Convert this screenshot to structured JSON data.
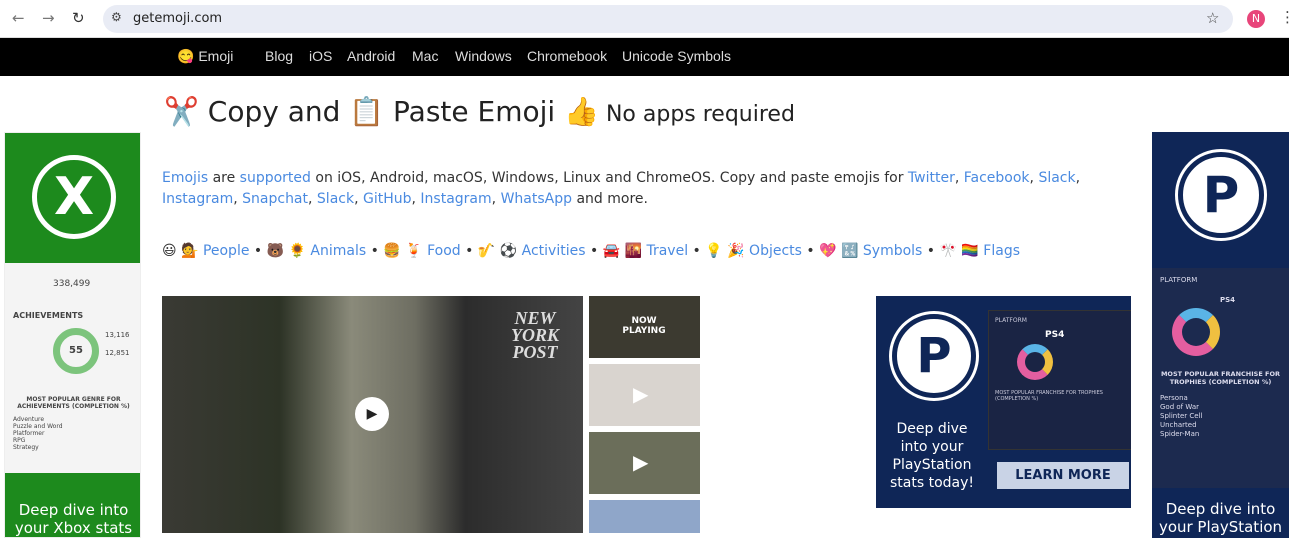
{
  "browser": {
    "url": "getemoji.com",
    "avatar": "N",
    "back": "←",
    "forward": "→",
    "reload": "↻",
    "star": "☆",
    "menu": "⋮"
  },
  "nav": {
    "items": [
      {
        "label": "😋 Emoji"
      },
      {
        "label": "Blog"
      },
      {
        "label": "iOS"
      },
      {
        "label": "Android"
      },
      {
        "label": "Mac"
      },
      {
        "label": "Windows"
      },
      {
        "label": "Chromebook"
      },
      {
        "label": "Unicode Symbols"
      }
    ]
  },
  "heading": {
    "scissors": "✂️",
    "part1": " Copy and ",
    "clipboard": "📋",
    "part2": " Paste Emoji ",
    "thumb": "👍",
    "tagline": " No apps required"
  },
  "intro": {
    "emojis": "Emojis",
    "are": " are ",
    "supported": "supported",
    "t1": " on iOS, Android, macOS, Windows, Linux and ChromeOS. Copy and paste emojis for ",
    "links": [
      "Twitter",
      "Facebook",
      "Slack",
      "Instagram",
      "Snapchat",
      "Slack",
      "GitHub",
      "Instagram",
      "WhatsApp"
    ],
    "end": " and more."
  },
  "categories": [
    {
      "emoji": "😃 💁",
      "label": "People"
    },
    {
      "emoji": "🐻 🌻",
      "label": "Animals"
    },
    {
      "emoji": "🍔 🍹",
      "label": "Food"
    },
    {
      "emoji": "🎷 ⚽️",
      "label": "Activities"
    },
    {
      "emoji": "🚘 🌇",
      "label": "Travel"
    },
    {
      "emoji": "💡 🎉",
      "label": "Objects"
    },
    {
      "emoji": "💖 🔣",
      "label": "Symbols"
    },
    {
      "emoji": "🎌 🏳️‍🌈",
      "label": "Flags"
    }
  ],
  "ads": {
    "left": {
      "count": "338,499",
      "section": "ACHIEVEMENTS",
      "ring": "55",
      "n1": "13,116",
      "n2": "12,851",
      "genre": "MOST POPULAR GENRE FOR ACHIEVEMENTS (COMPLETION %)",
      "rows": [
        "Adventure",
        "Puzzle and Word",
        "Platformer",
        "RPG",
        "Strategy"
      ],
      "cta": "Deep dive into your Xbox stats"
    },
    "middle": {
      "text": "Deep dive into your PlayStation stats today!",
      "button": "LEARN MORE",
      "platform": "PLATFORM",
      "console": "PS4",
      "franchise": "MOST POPULAR FRANCHISE FOR TROPHIES (COMPLETION %)"
    },
    "right": {
      "platform": "PLATFORM",
      "console": "PS4",
      "franchise": "MOST POPULAR FRANCHISE FOR TROPHIES (COMPLETION %)",
      "rows": [
        "Persona",
        "God of War",
        "Splinter Cell",
        "Uncharted",
        "Spider-Man"
      ],
      "cta": "Deep dive into your PlayStation"
    }
  },
  "video": {
    "watermark": "NEW YORK POST",
    "now_playing": "NOW PLAYING",
    "play": "▶"
  }
}
